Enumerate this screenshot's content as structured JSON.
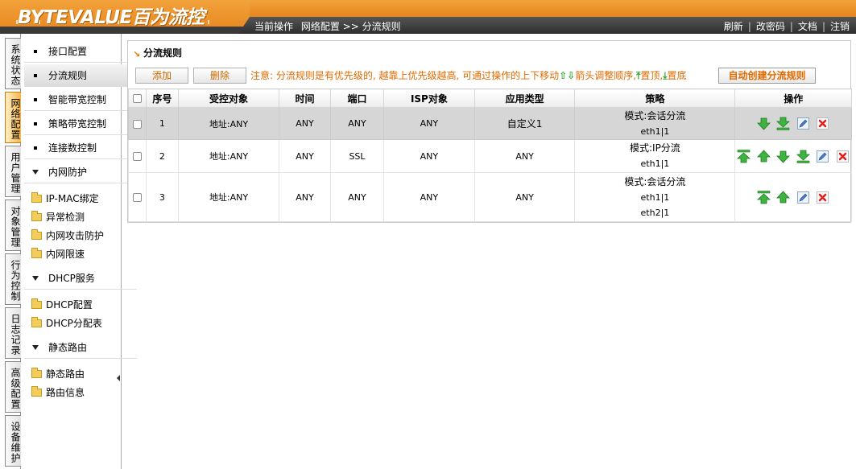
{
  "header": {
    "logo": "BYTEVALUE百为流控",
    "breadcrumb": [
      "当前操作",
      "网络配置 >> 分流规则"
    ],
    "links": [
      "刷新",
      "改密码",
      "文档",
      "注销"
    ]
  },
  "vtabs": [
    "系统状态",
    "网络配置",
    "用户管理",
    "对象管理",
    "行为控制",
    "日志记录",
    "高级配置",
    "设备维护"
  ],
  "submenu": {
    "items": [
      "接口配置",
      "分流规则",
      "智能带宽控制",
      "策略带宽控制",
      "连接数控制"
    ],
    "groups": [
      {
        "label": "内网防护",
        "children": [
          "IP-MAC绑定",
          "异常检测",
          "内网攻击防护",
          "内网限速"
        ]
      },
      {
        "label": "DHCP服务",
        "children": [
          "DHCP配置",
          "DHCP分配表"
        ]
      },
      {
        "label": "静态路由",
        "children": [
          "静态路由",
          "路由信息"
        ]
      }
    ]
  },
  "panel": {
    "title": "分流规则",
    "add_label": "添加",
    "delete_label": "删除",
    "note_1": "注意: 分流规则是有优先级的, 越靠上优先级越高, 可通过操作的上下移动",
    "note_2": "箭头调整顺序,",
    "note_3": "置顶,",
    "note_4": "置底",
    "auto_label": "自动创建分流规则",
    "columns": [
      "序号",
      "受控对象",
      "时间",
      "端口",
      "ISP对象",
      "应用类型",
      "策略",
      "操作"
    ],
    "rows": [
      {
        "id": "1",
        "object": "地址:ANY",
        "time": "ANY",
        "port": "ANY",
        "isp": "ANY",
        "app": "自定义1",
        "strategy": [
          "模式:会话分流",
          "eth1|1"
        ]
      },
      {
        "id": "2",
        "object": "地址:ANY",
        "time": "ANY",
        "port": "SSL",
        "isp": "ANY",
        "app": "ANY",
        "strategy": [
          "模式:IP分流",
          "eth1|1"
        ]
      },
      {
        "id": "3",
        "object": "地址:ANY",
        "time": "ANY",
        "port": "ANY",
        "isp": "ANY",
        "app": "ANY",
        "strategy": [
          "模式:会话分流",
          "eth1|1",
          "eth2|1"
        ]
      }
    ]
  },
  "colors": {
    "accent": "#e6851c",
    "note": "#e06a00",
    "arrow_green": "#2aa52a",
    "delete_red": "#e02020"
  }
}
